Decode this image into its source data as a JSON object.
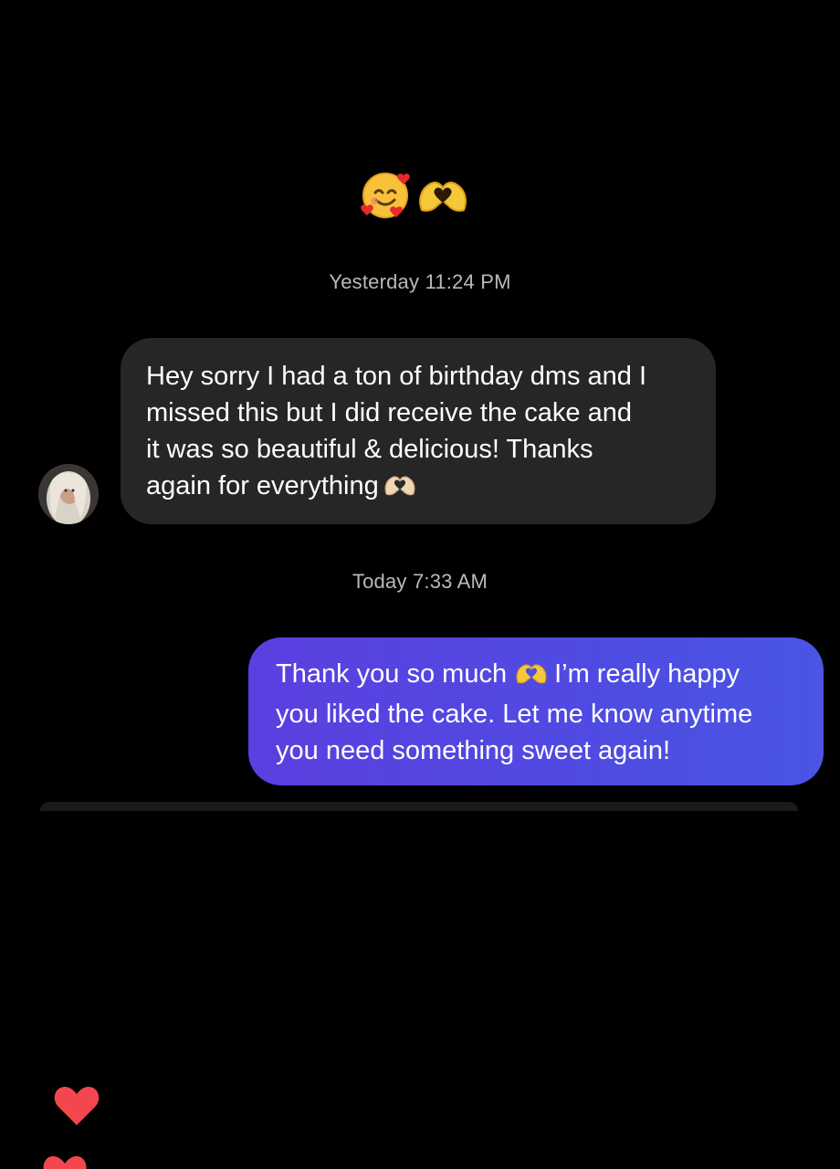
{
  "reactions": {
    "icons": [
      "smiling-face-with-hearts-icon",
      "heart-hands-icon"
    ]
  },
  "conversation": {
    "timestamps": {
      "first": "Yesterday 11:24 PM",
      "second": "Today 7:33 AM"
    },
    "incoming": {
      "lines": [
        "Hey sorry I had a ton of birthday dms and I",
        "missed this but I did receive the cake and",
        "it was so beautiful & delicious! Thanks",
        "again for everything"
      ],
      "trailing_icon": "heart-hands-icon"
    },
    "outgoing": {
      "line1_before_icon": "Thank you so much",
      "line1_after_icon": "I’m really happy",
      "line2": "you liked the cake. Let me know anytime",
      "line3": "you need something sweet again!",
      "inline_icon": "heart-hands-icon"
    }
  },
  "floating_reactions": {
    "icon": "heart-icon",
    "color": "#f2474f"
  },
  "colors": {
    "background": "#000000",
    "incoming_bubble": "#262626",
    "outgoing_bubble_start": "#5b3fe0",
    "outgoing_bubble_end": "#4a55e4",
    "timestamp_text": "#b9b9b9"
  }
}
